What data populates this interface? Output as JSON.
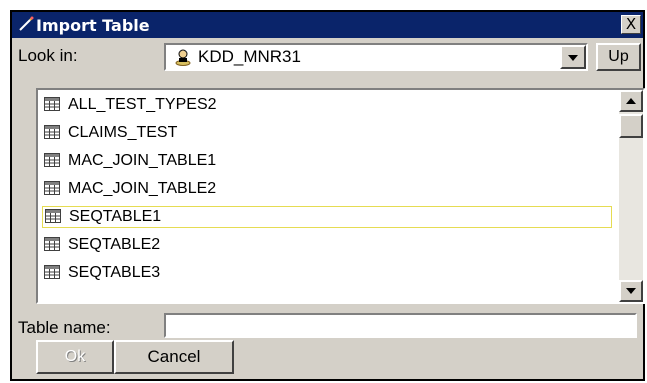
{
  "window": {
    "title": "Import Table",
    "close_label": "X"
  },
  "look_in": {
    "label": "Look in:",
    "value": "KDD_MNR31",
    "icon": "database-user-icon"
  },
  "up_button": {
    "label": "Up"
  },
  "tables": {
    "items": [
      {
        "label": "ALL_TEST_TYPES2",
        "selected": false
      },
      {
        "label": "CLAIMS_TEST",
        "selected": false
      },
      {
        "label": "MAC_JOIN_TABLE1",
        "selected": false
      },
      {
        "label": "MAC_JOIN_TABLE2",
        "selected": false
      },
      {
        "label": "SEQTABLE1",
        "selected": true
      },
      {
        "label": "SEQTABLE2",
        "selected": false
      },
      {
        "label": "SEQTABLE3",
        "selected": false
      }
    ],
    "item_icon": "table-icon"
  },
  "table_name": {
    "label": "Table name:",
    "value": "",
    "placeholder": ""
  },
  "buttons": {
    "ok_label": "Ok",
    "ok_enabled": false,
    "cancel_label": "Cancel"
  },
  "colors": {
    "titlebar": "#0a246a",
    "face": "#d4d0c8",
    "selection_border": "#e6dc52"
  }
}
